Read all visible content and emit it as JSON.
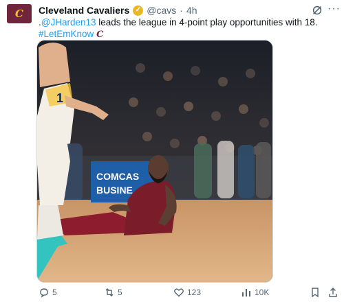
{
  "tweet": {
    "author_name": "Cleveland Cavaliers",
    "handle": "@cavs",
    "separator": "·",
    "time": "4h",
    "avatar_text": "C",
    "text_prefix": ".",
    "mention": "@JHarden13",
    "text_body": " leads the league in 4-point play opportunities with 18.",
    "hashtag": "#LetEmKnow",
    "hashtag_mark": "C",
    "more_label": "···"
  },
  "media": {
    "banner_line1": "COMCAS",
    "banner_line2": "BUSINE",
    "jersey_number": "1"
  },
  "actions": {
    "replies": "5",
    "reposts": "5",
    "likes": "123",
    "views": "10K"
  },
  "colors": {
    "cavs_wine": "#6f263d",
    "cavs_gold": "#fdbb30",
    "link_blue": "#1d9bf0",
    "muted": "#536471"
  }
}
